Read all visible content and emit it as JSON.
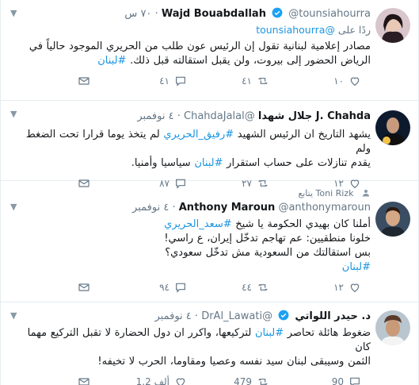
{
  "tweets": [
    {
      "name": "Wajd Bouabdallah",
      "verified": true,
      "handle": "@tounsiahourra",
      "time": "٧٠ س",
      "reply_prefix": "ردًا على",
      "reply_to": "@tounsiahourra",
      "line1": "مصادر إعلامية لبنانية تقول إن الرئيس عون طلب من الحريري الموجود حالياً في",
      "line2_text": "الرياض الحضور إلى بيروت، ولن يقبل استقالته قبل ذلك.",
      "line2_tag": "#لبنان",
      "replies": "٤١",
      "retweets": "٤١",
      "likes": "١٠"
    },
    {
      "name": "J. Chahda جلال شهدا",
      "verified": false,
      "handle": "@ChahdaJalal",
      "time": "٤ نوفمبر",
      "line1_text": "يشهد التاريخ ان الرئيس الشهيد",
      "line1_tag": "#رفيق_الحريري",
      "line1_rest": "لم يتخذ يوما قرارا تحت الضغط ولم",
      "line2_pre": "يقدم تنازلات على حساب استقرار",
      "line2_tag": "#لبنان",
      "line2_post": "سياسيا وأمنيا.",
      "replies": "١٢",
      "retweets": "٢٧",
      "likes": "٨٧"
    },
    {
      "retweeted_by": "Toni Rizk يتابع",
      "name": "Anthony Maroun",
      "verified": false,
      "handle": "@anthonymaroun",
      "time": "٤ نوفمبر",
      "line1": "أملنا كان بهيدي الحكومة يا شيخ",
      "line1_tag": "#سعد_الحريري",
      "line2": "خلونا منطقيين: عم تهاجم تدخّل إيران، ع راسي!",
      "line3": "بس استقالتك من السعودية مش تدخّل سعودي؟",
      "line4_tag": "#لبنان",
      "replies": "١٢",
      "retweets": "٤٤",
      "likes": "٩٤"
    },
    {
      "name": "د. حيدر اللواتي",
      "verified": true,
      "handle": "@DrAl_Lawati",
      "time": "٤ نوفمبر",
      "line1_pre": "ضغوط هائلة تحاصر",
      "line1_tag": "#لبنان",
      "line1_post": "لتركيعها، واكرر ان دول الحضارة لا تقبل التركيع مهما كان",
      "line2": "الثمن وسيبقى لبنان سيد نفسه وعصيا ومقاوما، الحرب لا تخيفه!",
      "replies": "90",
      "retweets": "479",
      "likes": "1.2 ألف"
    }
  ],
  "colors": {
    "link": "#1b95e0",
    "muted": "#657786",
    "verified": "#1da1f2",
    "border": "#e6ecf0"
  }
}
